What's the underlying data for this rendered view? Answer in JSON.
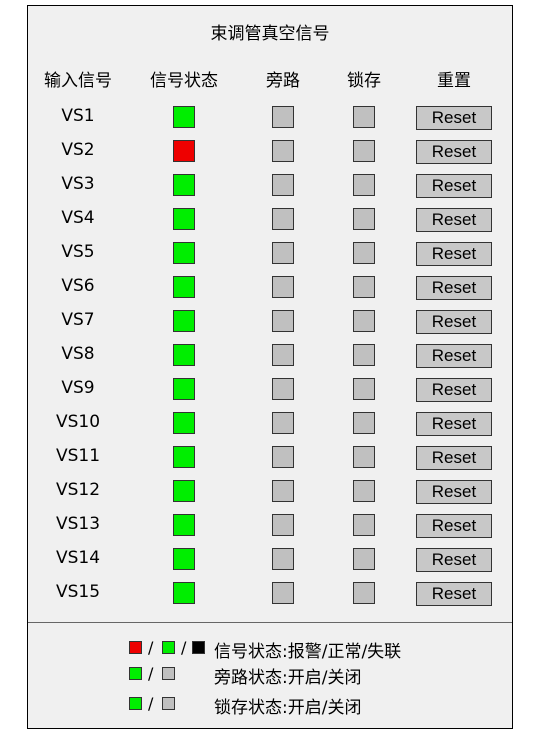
{
  "title": "束调管真空信号",
  "headers": {
    "input": "输入信号",
    "status": "信号状态",
    "bypass": "旁路",
    "lock": "锁存",
    "reset": "重置"
  },
  "colors": {
    "normal": "#00ee00",
    "alarm": "#ee0000",
    "lost": "#000000",
    "off": "#c0c0c0"
  },
  "rows": [
    {
      "name": "VS1",
      "status": "normal",
      "reset_label": "Reset"
    },
    {
      "name": "VS2",
      "status": "alarm",
      "reset_label": "Reset"
    },
    {
      "name": "VS3",
      "status": "normal",
      "reset_label": "Reset"
    },
    {
      "name": "VS4",
      "status": "normal",
      "reset_label": "Reset"
    },
    {
      "name": "VS5",
      "status": "normal",
      "reset_label": "Reset"
    },
    {
      "name": "VS6",
      "status": "normal",
      "reset_label": "Reset"
    },
    {
      "name": "VS7",
      "status": "normal",
      "reset_label": "Reset"
    },
    {
      "name": "VS8",
      "status": "normal",
      "reset_label": "Reset"
    },
    {
      "name": "VS9",
      "status": "normal",
      "reset_label": "Reset"
    },
    {
      "name": "VS10",
      "status": "normal",
      "reset_label": "Reset"
    },
    {
      "name": "VS11",
      "status": "normal",
      "reset_label": "Reset"
    },
    {
      "name": "VS12",
      "status": "normal",
      "reset_label": "Reset"
    },
    {
      "name": "VS13",
      "status": "normal",
      "reset_label": "Reset"
    },
    {
      "name": "VS14",
      "status": "normal",
      "reset_label": "Reset"
    },
    {
      "name": "VS15",
      "status": "normal",
      "reset_label": "Reset"
    }
  ],
  "legend": {
    "status_text": "信号状态:报警/正常/失联",
    "bypass_text": "旁路状态:开启/关闭",
    "lock_text": "锁存状态:开启/关闭",
    "slash": "/"
  }
}
